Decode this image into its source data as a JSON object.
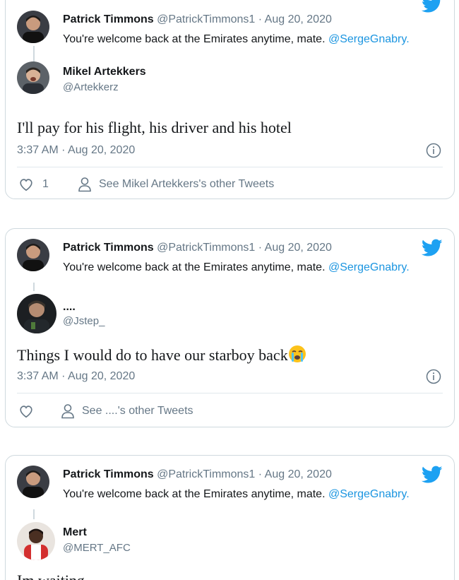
{
  "tweets": [
    {
      "reply": {
        "name": "Patrick Timmons",
        "handle": "@PatrickTimmons1",
        "date": "· Aug 20, 2020",
        "text_prefix": "You're welcome back at the Emirates anytime, mate. ",
        "mention": "@SergeGnabry."
      },
      "author": {
        "name": "Mikel Artekkers",
        "handle": "@Artekkerz"
      },
      "text": "I'll pay for his flight, his driver and his hotel",
      "timestamp": "3:37 AM · Aug 20, 2020",
      "like_count": "1",
      "see_other": "See Mikel Artekkers's other Tweets"
    },
    {
      "reply": {
        "name": "Patrick Timmons",
        "handle": "@PatrickTimmons1",
        "date": "· Aug 20, 2020",
        "text_prefix": "You're welcome back at the Emirates anytime, mate. ",
        "mention": "@SergeGnabry."
      },
      "author": {
        "name": "....",
        "handle": "@Jstep_"
      },
      "text": "Things I would do to have our starboy back",
      "emoji": "loudly-crying-face",
      "timestamp": "3:37 AM · Aug 20, 2020",
      "like_count": "",
      "see_other": "See ....'s other Tweets"
    },
    {
      "reply": {
        "name": "Patrick Timmons",
        "handle": "@PatrickTimmons1",
        "date": "· Aug 20, 2020",
        "text_prefix": "You're welcome back at the Emirates anytime, mate. ",
        "mention": "@SergeGnabry."
      },
      "author": {
        "name": "Mert",
        "handle": "@MERT_AFC"
      },
      "text": "Im waiting"
    }
  ],
  "colors": {
    "twitter_blue": "#1da1f2",
    "link_blue": "#1b95e0",
    "secondary_text": "#657786",
    "border": "#cfd9de"
  }
}
